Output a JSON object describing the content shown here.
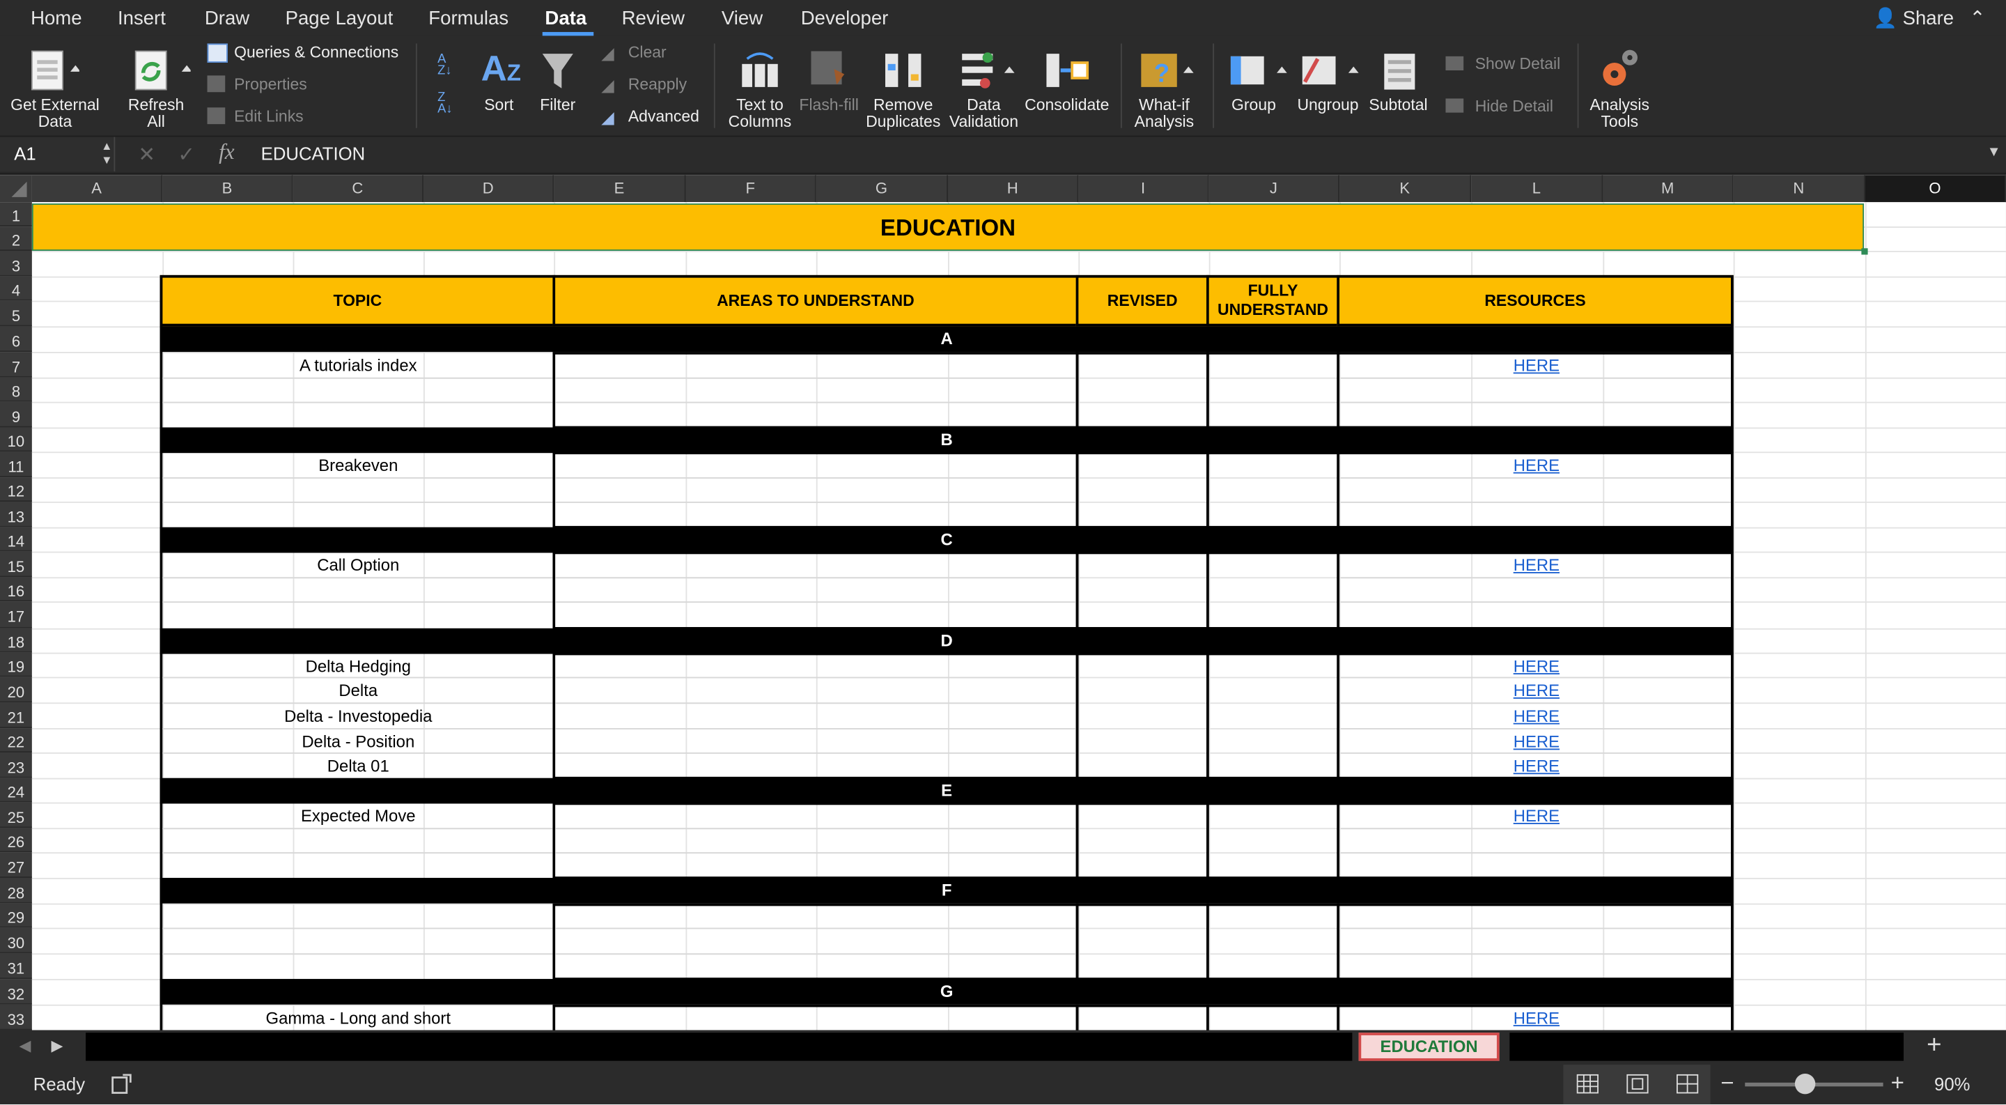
{
  "ribbon_tabs": [
    "Home",
    "Insert",
    "Draw",
    "Page Layout",
    "Formulas",
    "Data",
    "Review",
    "View",
    "Developer"
  ],
  "active_tab": "Data",
  "share_label": "Share",
  "ribbon": {
    "get_external_data": "Get External Data",
    "refresh_all": "Refresh All",
    "queries_connections": "Queries & Connections",
    "properties": "Properties",
    "edit_links": "Edit Links",
    "sort": "Sort",
    "filter": "Filter",
    "clear": "Clear",
    "reapply": "Reapply",
    "advanced": "Advanced",
    "text_to_columns": "Text to Columns",
    "flash_fill": "Flash-fill",
    "remove_duplicates": "Remove Duplicates",
    "data_validation": "Data Validation",
    "consolidate": "Consolidate",
    "what_if": "What-if Analysis",
    "group": "Group",
    "ungroup": "Ungroup",
    "subtotal": "Subtotal",
    "show_detail": "Show Detail",
    "hide_detail": "Hide Detail",
    "analysis_tools": "Analysis Tools"
  },
  "formula_bar": {
    "name_box": "A1",
    "fx": "fx",
    "value": "EDUCATION"
  },
  "columns": [
    "A",
    "B",
    "C",
    "D",
    "E",
    "F",
    "G",
    "H",
    "I",
    "J",
    "K",
    "L",
    "M",
    "N",
    "O"
  ],
  "selected_column": "O",
  "rows": [
    "1",
    "2",
    "3",
    "4",
    "5",
    "6",
    "7",
    "8",
    "9",
    "10",
    "11",
    "12",
    "13",
    "14",
    "15",
    "16",
    "17",
    "18",
    "19",
    "20",
    "21",
    "22",
    "23",
    "24",
    "25",
    "26",
    "27",
    "28",
    "29",
    "30",
    "31",
    "32",
    "33"
  ],
  "sheet": {
    "title": "EDUCATION",
    "headers": {
      "topic": "TOPIC",
      "areas": "AREAS TO UNDERSTAND",
      "revised": "REVISED",
      "fully": "FULLY UNDERSTAND",
      "resources": "RESOURCES"
    },
    "categories": [
      "A",
      "B",
      "C",
      "D",
      "E",
      "F",
      "G"
    ],
    "topics": [
      "A tutorials index",
      "Breakeven",
      "Call Option",
      "Delta Hedging",
      "Delta",
      "Delta - Investopedia",
      "Delta - Position",
      "Delta 01",
      "Expected Move",
      "Gamma - Long and short"
    ],
    "link_label": "HERE"
  },
  "sheet_tab": "EDUCATION",
  "status": {
    "ready": "Ready",
    "zoom": "90%"
  },
  "colors": {
    "header_fill": "#fdbd00",
    "category_fill": "#000000",
    "link": "#1a5fd0",
    "accent": "#4d9bf5"
  }
}
